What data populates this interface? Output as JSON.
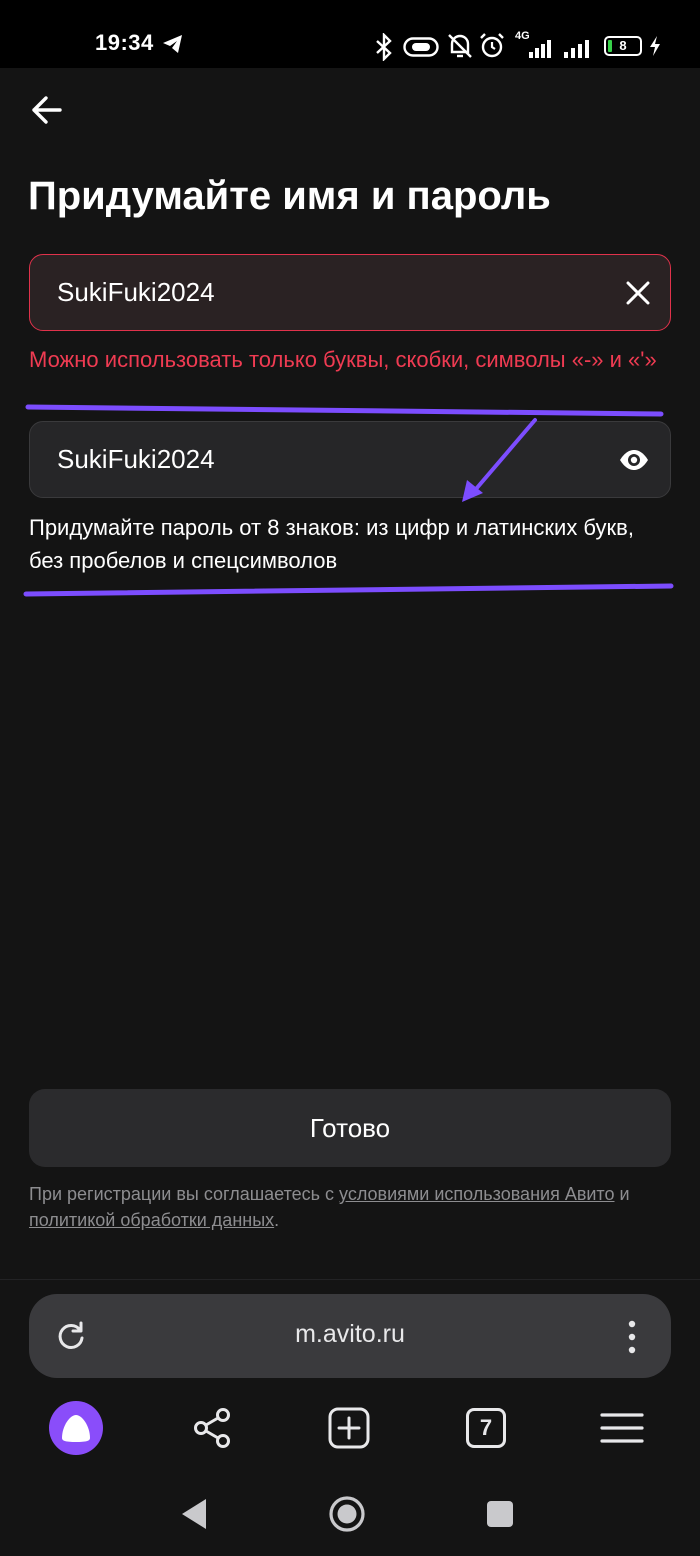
{
  "status_bar": {
    "time": "19:34",
    "network_label": "4G",
    "battery_level": "8"
  },
  "page": {
    "title": "Придумайте имя и пароль"
  },
  "name_field": {
    "value": "SukiFuki2024",
    "error": "Можно использовать только буквы, скобки, символы «-» и «'»"
  },
  "password_field": {
    "value": "SukiFuki2024",
    "hint": "Придумайте пароль от 8 знаков: из цифр и латинских букв, без пробелов и спецсимволов"
  },
  "actions": {
    "done_label": "Готово"
  },
  "legal": {
    "prefix": "При регистрации вы соглашаетесь с ",
    "terms_link": "условиями использования Авито",
    "middle": " и ",
    "privacy_link": "политикой обработки данных",
    "suffix": "."
  },
  "browser": {
    "url": "m.avito.ru",
    "tab_count": "7"
  },
  "colors": {
    "background": "#141414",
    "error": "#ef3b52",
    "annotation": "#7c4dff",
    "assistant": "#8a4dfa"
  },
  "icons": {
    "back": "arrow-left-icon",
    "clear": "close-icon",
    "show_password": "eye-icon",
    "reload": "reload-icon",
    "more": "more-vertical-icon",
    "assistant": "alice-icon",
    "share": "share-icon",
    "new_tab": "plus-square-icon",
    "tabs": "tabs-count-icon",
    "menu": "hamburger-menu-icon",
    "nav_back": "nav-back-icon",
    "nav_home": "nav-home-icon",
    "nav_recents": "nav-recents-icon"
  }
}
